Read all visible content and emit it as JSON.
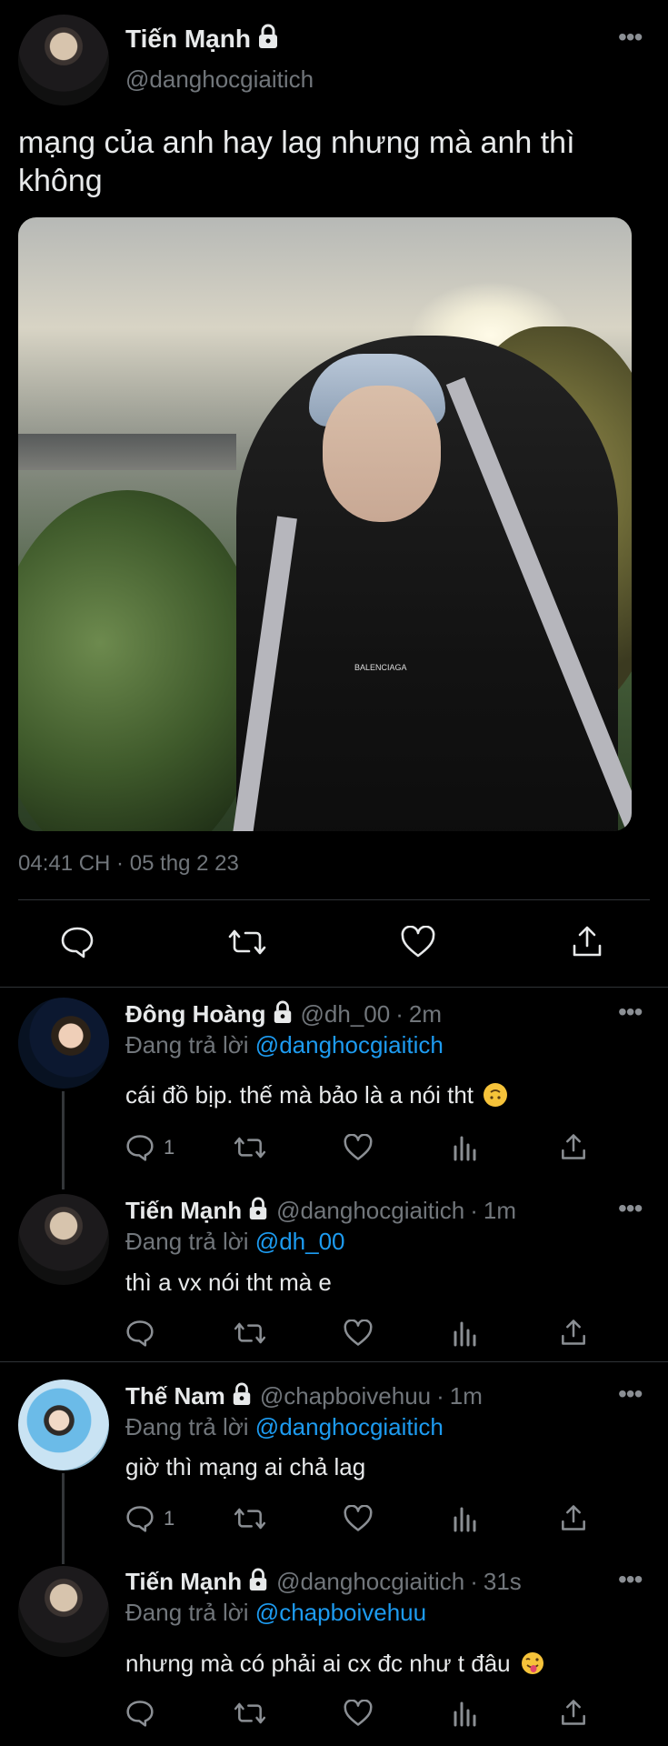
{
  "main_tweet": {
    "display_name": "Tiến Mạnh",
    "handle": "@danghocgiaitich",
    "text": "mạng của anh hay lag nhưng mà anh thì không",
    "timestamp": "04:41 CH · 05 thg 2 23",
    "photo_logo": "BALENCIAGA"
  },
  "replies": [
    {
      "display_name": "Đông Hoàng",
      "handle": "@dh_00",
      "time": "2m",
      "replying_label": "Đang trả lời",
      "replying_to": "@danghocgiaitich",
      "text": "cái đồ bịp. thế mà bảo là a nói tht",
      "reply_count": "1",
      "emoji": "upside-down-face"
    },
    {
      "display_name": "Tiến Mạnh",
      "handle": "@danghocgiaitich",
      "time": "1m",
      "replying_label": "Đang trả lời",
      "replying_to": "@dh_00",
      "text": "thì a vx nói tht mà e",
      "reply_count": ""
    },
    {
      "display_name": "Thế Nam",
      "handle": "@chapboivehuu",
      "time": "1m",
      "replying_label": "Đang trả lời",
      "replying_to": "@danghocgiaitich",
      "text": "giờ thì mạng ai chả lag",
      "reply_count": "1"
    },
    {
      "display_name": "Tiến Mạnh",
      "handle": "@danghocgiaitich",
      "time": "31s",
      "replying_label": "Đang trả lời",
      "replying_to": "@chapboivehuu",
      "text": "nhưng mà có phải ai cx đc như t đâu",
      "reply_count": "",
      "emoji": "tongue-out-face"
    }
  ],
  "icons": {
    "more": "more-icon",
    "lock": "lock-icon",
    "reply": "reply-icon",
    "retweet": "retweet-icon",
    "like": "heart-icon",
    "views": "views-icon",
    "share": "share-icon"
  },
  "colors": {
    "background": "#000000",
    "text": "#e7e9ea",
    "secondary": "#71767b",
    "link": "#1d9bf0",
    "divider": "#2f3336"
  }
}
